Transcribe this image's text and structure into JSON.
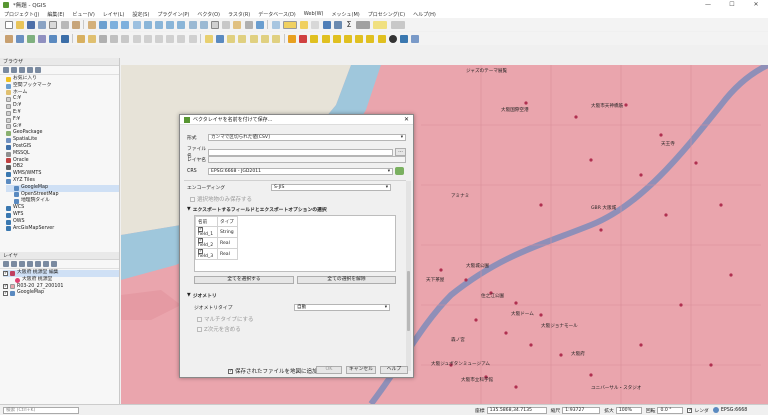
{
  "window": {
    "title": "*無題 - QGIS",
    "controls": [
      "—",
      "☐",
      "✕"
    ]
  },
  "menu": [
    "プロジェクト(J)",
    "編集(E)",
    "ビュー(V)",
    "レイヤ(L)",
    "設定(S)",
    "プラグイン(P)",
    "ベクタ(O)",
    "ラスタ(R)",
    "データベース(D)",
    "Web(W)",
    "メッシュ(M)",
    "プロセシング(C)",
    "ヘルプ(H)"
  ],
  "browser": {
    "title": "ブラウザ",
    "items": [
      "お気に入り",
      "空間ブックマーク",
      "ホーム",
      "C:¥",
      "D:¥",
      "E:¥",
      "F:¥",
      "G:¥",
      "GeoPackage",
      "SpatiaLite",
      "PostGIS",
      "MSSQL",
      "Oracle",
      "DB2",
      "WMS/WMTS",
      "XYZ Tiles",
      "GoogleMap",
      "OpenStreetMap",
      "地理院タイル",
      "WCS",
      "WFS",
      "OWS",
      "ArcGisMapServer"
    ]
  },
  "layers": {
    "title": "レイヤ",
    "items": [
      "大阪府 桃源堂 編集",
      "大阪府 桃源堂",
      "R03-20_27_200101",
      "GoogleMap"
    ]
  },
  "map": {
    "labels": [
      "ジャズのテーマ展覧",
      "大阪国際空港",
      "大阪市天神橋筋",
      "天王寺",
      "アミナミ",
      "GBR 大阪城",
      "大阪城公園",
      "天下茶屋",
      "住之江公園",
      "大阪ドーム",
      "大阪ジョナモール",
      "森ノ宮",
      "大阪府",
      "大阪ジュボタンミュージアム",
      "大阪市立科学館",
      "ユニバーサル・スタジオ"
    ]
  },
  "dialog": {
    "title": "ベクタレイヤを名前を付けて保存...",
    "close": "✕",
    "format_label": "形式",
    "format_value": "カンマで区切られた値[CSV]",
    "filename_label": "ファイル名",
    "filename_value": "",
    "browse": "…",
    "layername_label": "レイヤ名",
    "layername_value": "",
    "crs_label": "CRS",
    "crs_value": "EPSG:6668 - JGD2011",
    "encoding_label": "エンコーディング",
    "encoding_value": "S-JIS",
    "selected_only": "選択地物のみ保存する",
    "fields_section": "エクスポートするフィールドとエクスポートオプションの選択",
    "fields_headers": [
      "名前",
      "タイプ"
    ],
    "fields": [
      {
        "name": "field_1",
        "type": "String"
      },
      {
        "name": "field_2",
        "type": "Real"
      },
      {
        "name": "field_3",
        "type": "Real"
      }
    ],
    "select_all": "全てを選択する",
    "deselect_all": "全ての選択を解除",
    "geometry_section": "ジオメトリ",
    "geomtype_label": "ジオメトリタイプ",
    "geomtype_value": "自動",
    "multi": "マルチタイプにする",
    "zdim": "Z次元を含める",
    "add_to_map": "保存されたファイルを地図に追加する",
    "ok": "OK",
    "cancel": "キャンセル",
    "help": "ヘルプ"
  },
  "status": {
    "search_placeholder": "検索 (Ctrl+K)",
    "coord_label": "座標",
    "coord_value": "135.5868,34.7135",
    "scale_label": "縮尺",
    "scale_value": "1:93727",
    "magnify_label": "拡大",
    "magnify_value": "100%",
    "rotation_label": "回転",
    "rotation_value": "0.0 °",
    "render_label": "レンダ",
    "crs_value": "EPSG:6668"
  }
}
